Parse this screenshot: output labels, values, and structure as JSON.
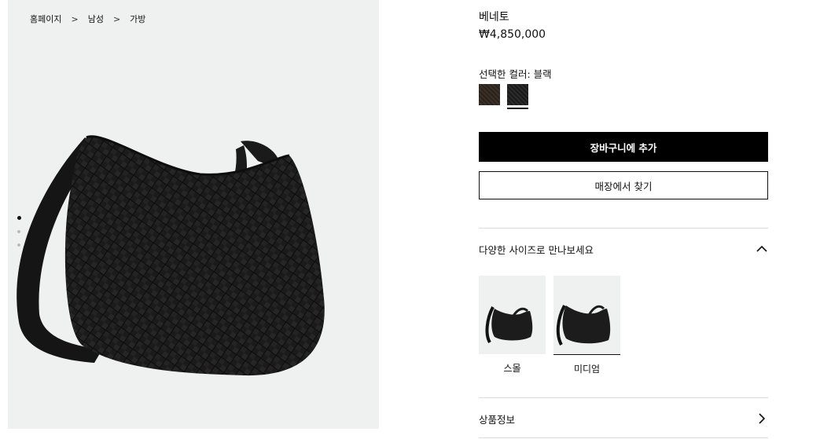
{
  "breadcrumb": {
    "items": [
      "홈페이지",
      "남성",
      "가방"
    ],
    "separator": ">"
  },
  "gallery": {
    "slides": 3,
    "active_slide": 1
  },
  "product": {
    "name": "베네토",
    "price": "₩4,850,000"
  },
  "color": {
    "label": "선택한 컬러: 블랙",
    "options": [
      {
        "name": "brown",
        "color": "#2f2620"
      },
      {
        "name": "black",
        "color": "#1f1f1f",
        "selected": true
      }
    ]
  },
  "buttons": {
    "add_to_cart": "장바구니에 추가",
    "find_in_store": "매장에서 찾기"
  },
  "sizes": {
    "title": "다양한 사이즈로 만나보세요",
    "options": [
      {
        "label": "스몰",
        "selected": false
      },
      {
        "label": "미디엄",
        "selected": true
      }
    ]
  },
  "product_info": {
    "title": "상품정보"
  }
}
